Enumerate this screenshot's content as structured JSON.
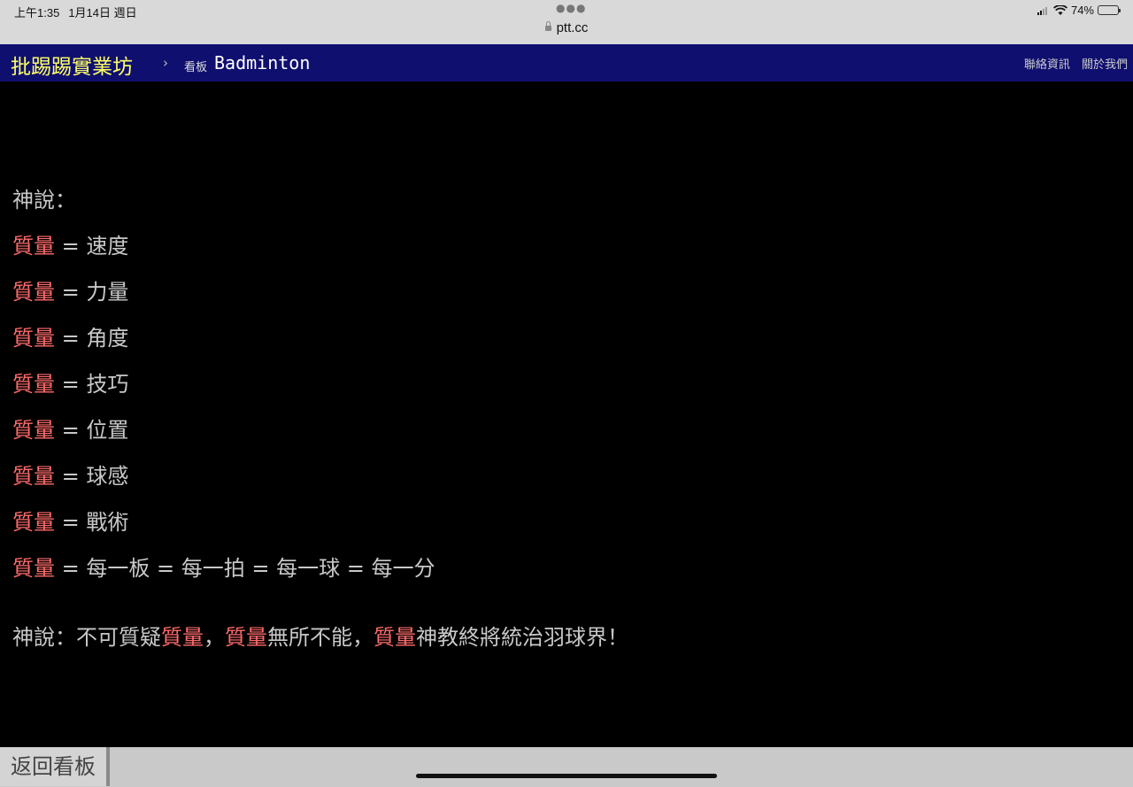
{
  "status_bar": {
    "time": "上午1:35",
    "date": "1月14日 週日",
    "url": "ptt.cc",
    "battery": "74%",
    "battery_level": 0.74
  },
  "header": {
    "site_title": "批踢踢實業坊",
    "separator": "›",
    "board_label": "看板",
    "board_name": "Badminton",
    "links": [
      "聯絡資訊",
      "關於我們"
    ]
  },
  "article": {
    "intro": "神說：",
    "red_word": "質量",
    "eq": " = ",
    "definitions": [
      "速度",
      "力量",
      "角度",
      "技巧",
      "位置",
      "球感",
      "戰術"
    ],
    "last_line": [
      "每一板",
      "每一拍",
      "每一球",
      "每一分"
    ],
    "closing": {
      "a": "神說：不可質疑",
      "b": "質量",
      "c": "，",
      "d": "質量",
      "e": "無所不能，",
      "f": "質量",
      "g": "神教終將統治羽球界！"
    }
  },
  "footer": {
    "back_label": "返回看板"
  },
  "colors": {
    "topbar": "#0f0f70",
    "logo": "#ffff66",
    "highlight": "#ff6b6b",
    "text": "#c8c8c8"
  }
}
